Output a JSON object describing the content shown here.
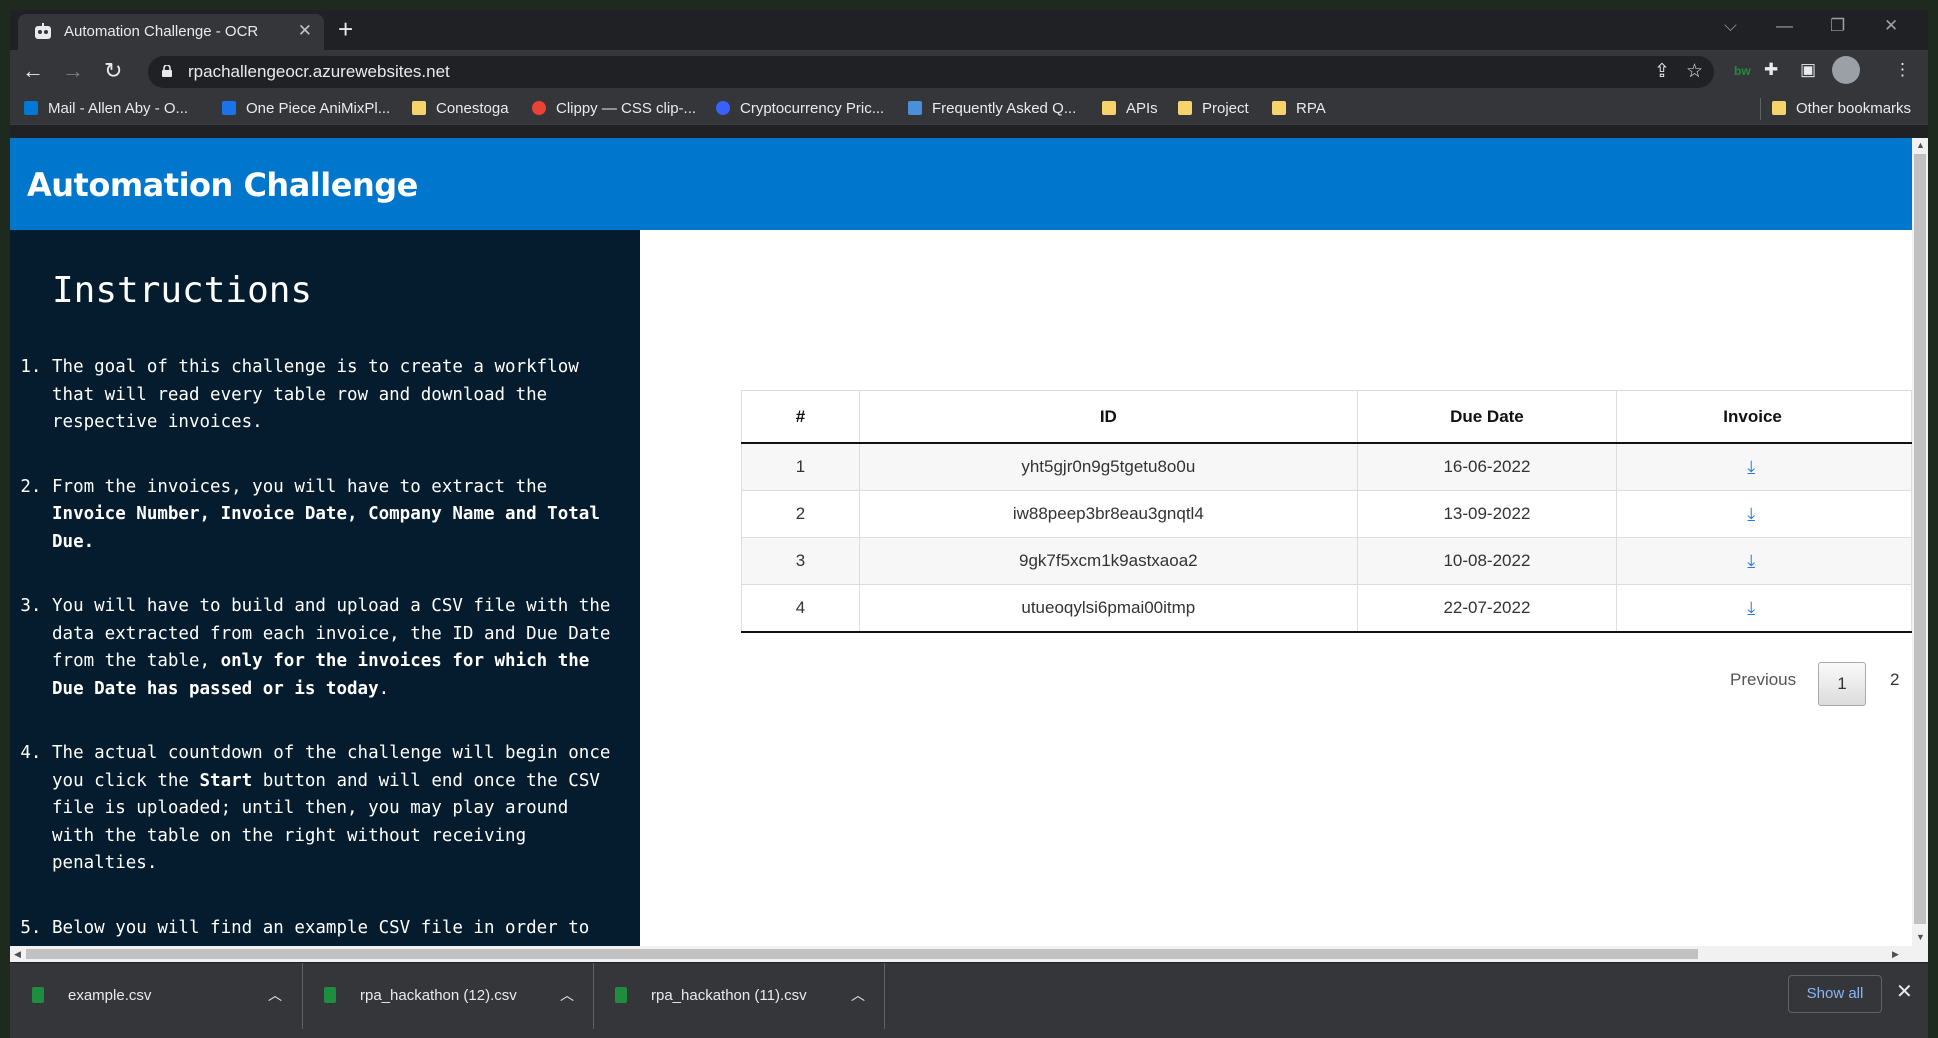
{
  "browser": {
    "tab_title": "Automation Challenge - OCR",
    "url": "rpachallengeocr.azurewebsites.net",
    "bookmarks": [
      {
        "label": "Mail - Allen Aby - O...",
        "color": "#0078d4"
      },
      {
        "label": "One Piece AniMixPl...",
        "color": "#1a73e8"
      },
      {
        "label": "Conestoga",
        "color": "#f5d46b"
      },
      {
        "label": "Clippy — CSS clip-...",
        "color": "#ea4335"
      },
      {
        "label": "Cryptocurrency Pric...",
        "color": "#3861fb"
      },
      {
        "label": "Frequently Asked Q...",
        "color": "#4a90d9"
      },
      {
        "label": "APIs",
        "color": "#f5d46b"
      },
      {
        "label": "Project",
        "color": "#f5d46b"
      },
      {
        "label": "RPA",
        "color": "#f5d46b"
      }
    ],
    "other_bookmarks": "Other bookmarks",
    "extension_label": "bw"
  },
  "page": {
    "header_title": "Automation Challenge",
    "instructions_title": "Instructions",
    "instructions": {
      "i1": "The goal of this challenge is to create a workflow that will read every table row and download the respective invoices.",
      "i2a": "From the invoices, you will have to extract the ",
      "i2b": "Invoice Number, Invoice Date, Company Name and Total Due",
      "i2c": ".",
      "i3a": "You will have to build and upload a CSV file with the data extracted from each invoice, the ID and Due Date from the table, ",
      "i3b": "only for the invoices for which the Due Date has passed or is today",
      "i3c": ".",
      "i4a": "The actual countdown of the challenge will begin once you click the ",
      "i4b": "Start",
      "i4c": " button and will end once the CSV file is uploaded; until then, you may play around with the table on the right without receiving penalties.",
      "i5": "Below you will find an example CSV file in order to"
    },
    "table": {
      "headers": [
        "#",
        "ID",
        "Due Date",
        "Invoice"
      ],
      "rows": [
        {
          "num": "1",
          "id": "yht5gjr0n9g5tgetu8o0u",
          "due": "16-06-2022"
        },
        {
          "num": "2",
          "id": "iw88peep3br8eau3gnqtl4",
          "due": "13-09-2022"
        },
        {
          "num": "3",
          "id": "9gk7f5xcm1k9astxaoa2",
          "due": "10-08-2022"
        },
        {
          "num": "4",
          "id": "utueoqylsi6pmai00itmp",
          "due": "22-07-2022"
        }
      ]
    },
    "pagination": {
      "previous": "Previous",
      "current": "1",
      "next_page": "2"
    }
  },
  "downloads": {
    "items": [
      "example.csv",
      "rpa_hackathon (12).csv",
      "rpa_hackathon (11).csv"
    ],
    "show_all": "Show all"
  }
}
